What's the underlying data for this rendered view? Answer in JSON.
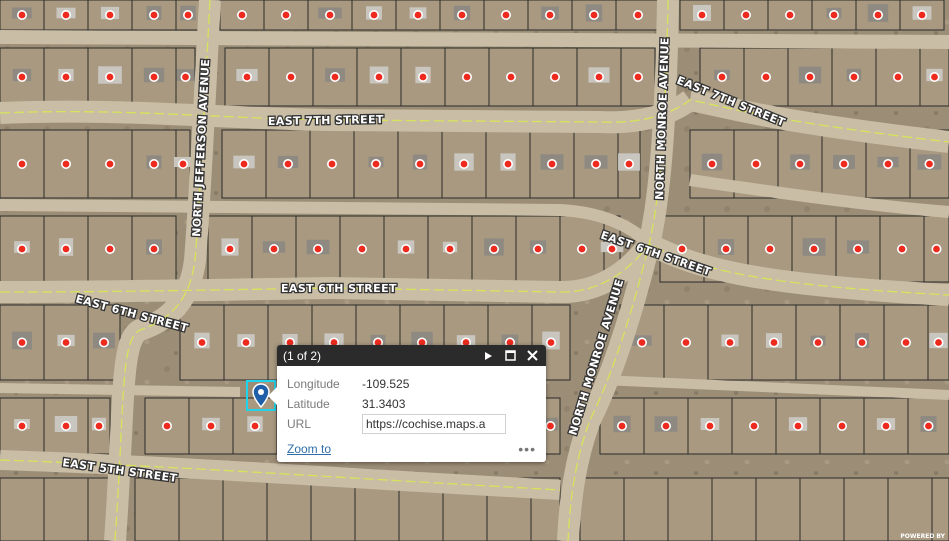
{
  "map": {
    "streets": [
      {
        "key": "e7",
        "label": "EAST 7TH STREET"
      },
      {
        "key": "e7r",
        "label": "EAST 7TH STREET"
      },
      {
        "key": "e6",
        "label": "EAST 6TH STREET"
      },
      {
        "key": "e6l",
        "label": "EAST 6TH STREET"
      },
      {
        "key": "e6r",
        "label": "EAST 6TH STREET"
      },
      {
        "key": "e5",
        "label": "EAST 5TH STREET"
      },
      {
        "key": "jeff",
        "label": "NORTH JEFFERSON AVENUE"
      },
      {
        "key": "mon1",
        "label": "NORTH MONROE AVENUE"
      },
      {
        "key": "mon2",
        "label": "NORTH MONROE AVENUE"
      }
    ],
    "colors": {
      "terrain": "#9c8d76",
      "road": "#c9bda6",
      "parcel_line": "#2a2a2a",
      "centerline": "#d7e35a",
      "dot": "#ee2a1e",
      "highlight": "#1fd3ea",
      "marker": "#1f5fa8"
    },
    "icons": {
      "marker": "map-pin-icon"
    }
  },
  "popup": {
    "count": "(1 of 2)",
    "fields": [
      {
        "key": "Longitude",
        "value": "-109.525"
      },
      {
        "key": "Latitude",
        "value": "31.3403"
      },
      {
        "key": "URL",
        "value": "https://cochise.maps.a"
      }
    ],
    "zoom_label": "Zoom to",
    "more": "•••",
    "icons": {
      "next": "play-next-icon",
      "maximize": "maximize-icon",
      "close": "close-icon"
    }
  },
  "attribution": "POWERED BY"
}
